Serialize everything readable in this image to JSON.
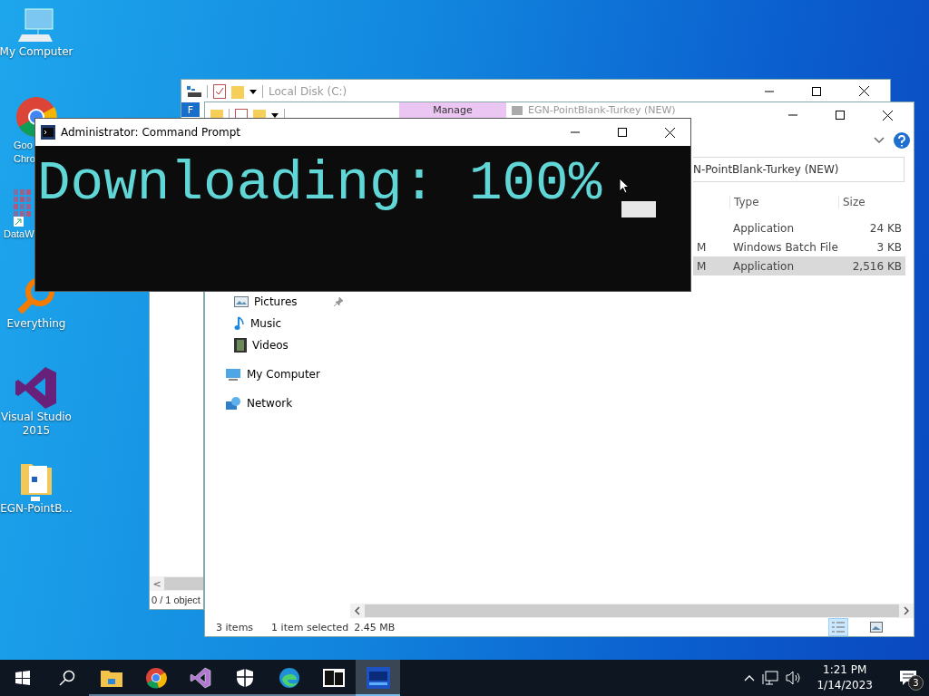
{
  "desktop_icons": [
    {
      "kind": "computer",
      "lines": [
        "My Computer"
      ]
    },
    {
      "kind": "chrome",
      "lines": [
        "Goo",
        "Chro"
      ]
    },
    {
      "kind": "datawin",
      "lines": [
        "DataW"
      ]
    },
    {
      "kind": "everything",
      "lines": [
        "Everything"
      ]
    },
    {
      "kind": "visualstudio",
      "lines": [
        "Visual Studio",
        "2015"
      ]
    },
    {
      "kind": "folder",
      "lines": [
        "EGN-PointB..."
      ]
    }
  ],
  "explorer_side": {
    "status": "0 / 1 object",
    "scroll_left": "<"
  },
  "explorer_back": {
    "title": "Local Disk (C:)",
    "file_tab": "F"
  },
  "explorer": {
    "context_tab": "Manage",
    "title": "EGN-PointBlank-Turkey (NEW)",
    "address": "N-PointBlank-Turkey (NEW)",
    "columns": [
      "Type",
      "Size"
    ],
    "rows": [
      {
        "type": "Application",
        "size": "24 KB",
        "selected": false
      },
      {
        "date_tail": "M",
        "type": "Windows Batch File",
        "size": "3 KB",
        "selected": false
      },
      {
        "date_tail": "M",
        "type": "Application",
        "size": "2,516 KB",
        "selected": true
      }
    ],
    "quick_access": [
      {
        "kind": "pictures",
        "label": "Pictures",
        "pinned": true
      },
      {
        "kind": "music",
        "label": "Music",
        "pinned": false
      },
      {
        "kind": "videos",
        "label": "Videos",
        "pinned": false
      }
    ],
    "locations": [
      {
        "kind": "computer",
        "label": "My Computer"
      },
      {
        "kind": "network",
        "label": "Network"
      }
    ],
    "status": {
      "count": "3 items",
      "selection": "1 item selected",
      "size": "2.45 MB"
    },
    "views": [
      {
        "kind": "details",
        "selected": true
      },
      {
        "kind": "tiles",
        "selected": false
      }
    ]
  },
  "cmd": {
    "title": "Administrator:  Command Prompt",
    "output": "Downloading: 100%"
  },
  "taskbar": {
    "apps": [
      {
        "kind": "explorer",
        "running": true,
        "active": false
      },
      {
        "kind": "chrome",
        "running": true,
        "active": false
      },
      {
        "kind": "visualstudio",
        "running": true,
        "active": false
      },
      {
        "kind": "security",
        "running": true,
        "active": false
      },
      {
        "kind": "edge",
        "running": true,
        "active": false
      },
      {
        "kind": "sevenzip",
        "running": true,
        "active": false
      },
      {
        "kind": "egn",
        "running": true,
        "active": true
      }
    ],
    "time": "1:21 PM",
    "date": "1/14/2023",
    "notifications": "3"
  }
}
